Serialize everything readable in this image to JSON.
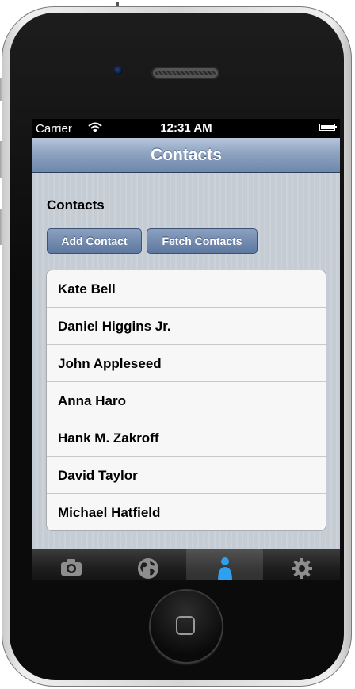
{
  "status_bar": {
    "carrier": "Carrier",
    "time": "12:31 AM"
  },
  "nav": {
    "title": "Contacts"
  },
  "section": {
    "title": "Contacts"
  },
  "buttons": {
    "add_contact": "Add Contact",
    "fetch_contacts": "Fetch Contacts"
  },
  "contacts": [
    "Kate Bell",
    "Daniel Higgins Jr.",
    "John Appleseed",
    "Anna Haro",
    "Hank M. Zakroff",
    "David Taylor",
    "Michael Hatfield"
  ],
  "tabs": [
    {
      "icon": "camera-icon",
      "selected": false
    },
    {
      "icon": "globe-icon",
      "selected": false
    },
    {
      "icon": "person-icon",
      "selected": true
    },
    {
      "icon": "gear-icon",
      "selected": false
    }
  ],
  "colors": {
    "nav_bar": "#8ea3c0",
    "button": "#5e78a0",
    "selected_tab_icon": "#2ea0f0",
    "tab_icon": "#8e8e8e"
  }
}
